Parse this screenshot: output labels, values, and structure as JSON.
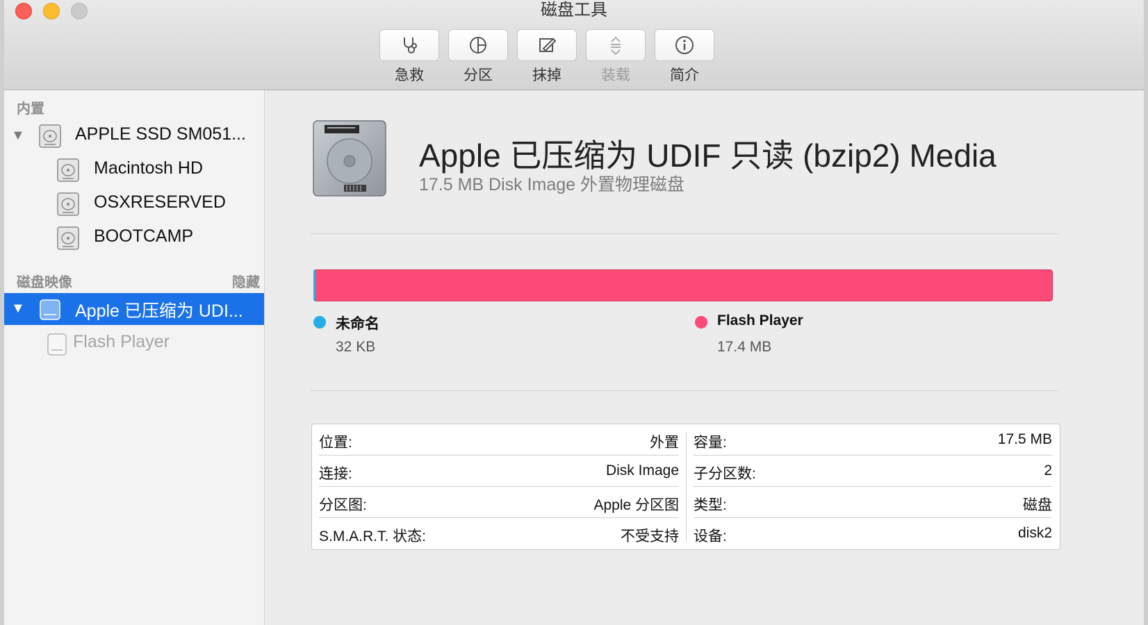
{
  "window": {
    "title": "磁盘工具"
  },
  "toolbar": {
    "first_aid": "急救",
    "partition": "分区",
    "erase": "抹掉",
    "mount": "装载",
    "info": "简介"
  },
  "sidebar": {
    "internal_header": "内置",
    "internal_items": [
      {
        "label": "APPLE SSD SM051..."
      },
      {
        "label": "Macintosh HD"
      },
      {
        "label": "OSXRESERVED"
      },
      {
        "label": "BOOTCAMP"
      }
    ],
    "images_header": "磁盘映像",
    "hide_label": "隐藏",
    "image_items": [
      {
        "label": "Apple 已压缩为 UDI...",
        "selected": true
      },
      {
        "label": "Flash Player",
        "dimmed": true
      }
    ]
  },
  "detail": {
    "title": "Apple 已压缩为 UDIF 只读 (bzip2) Media",
    "subtitle": "17.5 MB Disk Image 外置物理磁盘",
    "usage": {
      "segments": [
        {
          "name": "未命名",
          "size": "32 KB",
          "color": "#28aee6"
        },
        {
          "name": "Flash Player",
          "size": "17.4 MB",
          "color": "#fb4a78"
        }
      ]
    },
    "info_left": [
      {
        "key": "位置:",
        "value": "外置"
      },
      {
        "key": "连接:",
        "value": "Disk Image"
      },
      {
        "key": "分区图:",
        "value": "Apple 分区图"
      },
      {
        "key": "S.M.A.R.T. 状态:",
        "value": "不受支持"
      }
    ],
    "info_right": [
      {
        "key": "容量:",
        "value": "17.5 MB"
      },
      {
        "key": "子分区数:",
        "value": "2"
      },
      {
        "key": "类型:",
        "value": "磁盘"
      },
      {
        "key": "设备:",
        "value": "disk2"
      }
    ]
  }
}
